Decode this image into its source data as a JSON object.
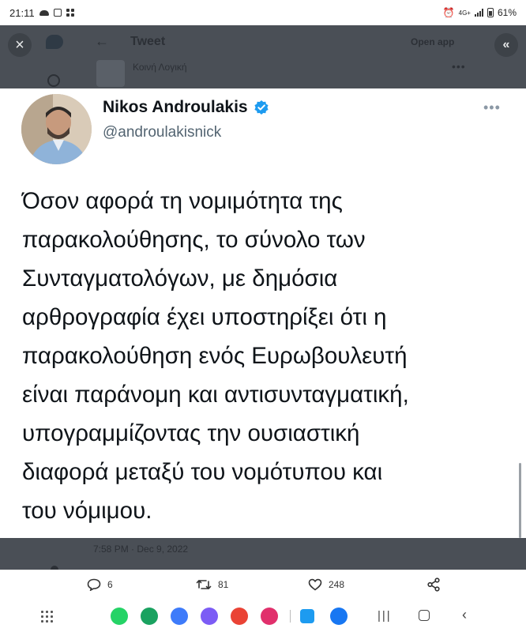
{
  "status_bar": {
    "time": "21:11",
    "battery": "61%",
    "network": "4G+"
  },
  "background_tweet": {
    "title": "Tweet",
    "open_app": "Open app",
    "close": "×",
    "collapse": "«",
    "back": "←",
    "user_line": "Κοινή Λογική",
    "timestamp": "7:58 PM · Dec 9, 2022"
  },
  "tweet": {
    "author_name": "Nikos Androulakis",
    "handle": "@androulakisnick",
    "more": "•••",
    "text": "Όσον αφορά τη νομιμότητα της\nπαρακολούθησης, το σύνολο των\nΣυνταγματολόγων, με δημόσια\nαρθρογραφία έχει υποστηρίξει ότι η\nπαρακολούθηση ενός Ευρωβουλευτή\nείναι παράνομη και αντισυνταγματική,\nυπογραμμίζοντας την ουσιαστική\nδιαφορά μεταξύ του νομότυπου και\nτου νόμιμου."
  },
  "actions": {
    "replies": "6",
    "retweets": "81",
    "likes": "248"
  },
  "colors": {
    "verified": "#1d9bf0",
    "dim_overlay": "#4a4f56",
    "text": "#0f1419",
    "handle": "#536471"
  },
  "nav_apps": [
    {
      "name": "whatsapp-icon",
      "color": "#25d366"
    },
    {
      "name": "phone-icon",
      "color": "#1aa260"
    },
    {
      "name": "messages-icon",
      "color": "#3e7bfa"
    },
    {
      "name": "signal-icon",
      "color": "#7c5cf5"
    },
    {
      "name": "chrome-icon",
      "color": "#ea4335"
    },
    {
      "name": "instagram-icon",
      "color": "#e1306c"
    },
    {
      "name": "twitter-icon",
      "color": "#1d9bf0"
    },
    {
      "name": "facebook-icon",
      "color": "#1877f2"
    }
  ]
}
